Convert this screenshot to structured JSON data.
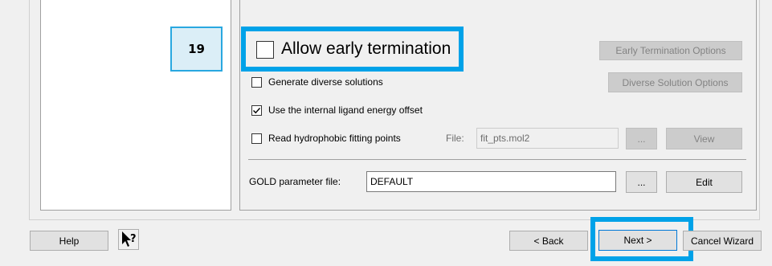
{
  "step_number": "19",
  "options": {
    "early_termination": {
      "label": "Allow early termination",
      "checked": false,
      "button": "Early Termination Options"
    },
    "diverse_solutions": {
      "label": "Generate diverse solutions",
      "checked": false,
      "button": "Diverse Solution Options"
    },
    "ligand_energy_offset": {
      "label": "Use the internal ligand energy offset",
      "checked": true
    },
    "hydrophobic_points": {
      "label": "Read hydrophobic fitting points",
      "checked": false,
      "file_label": "File:",
      "file_value": "fit_pts.mol2",
      "browse_label": "...",
      "view_label": "View"
    }
  },
  "parameter_file": {
    "label": "GOLD parameter file:",
    "value": "DEFAULT",
    "browse_label": "...",
    "edit_label": "Edit"
  },
  "footer": {
    "help_label": "Help",
    "back_label": "< Back",
    "next_label": "Next >",
    "cancel_label": "Cancel Wizard"
  },
  "colors": {
    "highlight": "#00a2e8",
    "badge_border": "#29a8e0",
    "badge_fill": "#dbeef7"
  },
  "icons": {
    "context_help": "pointer-question-icon",
    "checkmark": "checkmark-icon"
  }
}
